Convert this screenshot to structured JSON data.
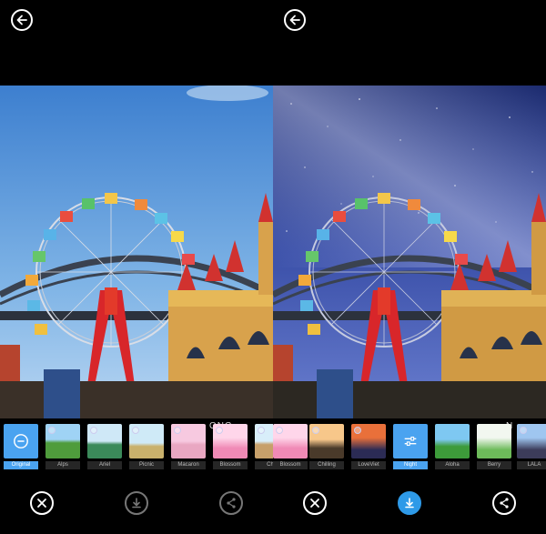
{
  "screens": [
    {
      "filters": [
        {
          "label": "Original",
          "selected": true,
          "colors": [
            "#4aa3f0",
            "#4aa3f0"
          ]
        },
        {
          "label": "Alps",
          "colors": [
            "#9fd3f5",
            "#4f9c3c"
          ]
        },
        {
          "label": "Ariel",
          "colors": [
            "#cfe8f7",
            "#3b8a5a"
          ]
        },
        {
          "label": "Picnic",
          "colors": [
            "#cfeaf7",
            "#c9b16c"
          ]
        },
        {
          "label": "Macaron",
          "colors": [
            "#f7c9e0",
            "#e9a7c2"
          ]
        },
        {
          "label": "Blossom",
          "colors": [
            "#ffd6ea",
            "#f08ab6"
          ]
        },
        {
          "label": "Chill",
          "colors": [
            "#d8eefa",
            "#c7a06a"
          ]
        }
      ],
      "caption": "ONC",
      "buttons": {
        "close": "close",
        "download": "download",
        "share": "share"
      }
    },
    {
      "filters": [
        {
          "label": "Blossom",
          "colors": [
            "#ffd6ea",
            "#f08ab6"
          ]
        },
        {
          "label": "Chilling",
          "colors": [
            "#f7c78a",
            "#4a3a2a"
          ]
        },
        {
          "label": "LoveViet",
          "colors": [
            "#e9703a",
            "#2b2b55"
          ]
        },
        {
          "label": "Night",
          "selected": true,
          "colors": [
            "#4aa3f0",
            "#4aa3f0"
          ]
        },
        {
          "label": "Aloha",
          "colors": [
            "#7ec8f2",
            "#3d9b3a"
          ]
        },
        {
          "label": "Berry",
          "colors": [
            "#f2f7f0",
            "#6dbb5a"
          ]
        },
        {
          "label": "LALA",
          "colors": [
            "#9fc6f0",
            "#3c3c5a"
          ]
        }
      ],
      "caption": "N",
      "buttons": {
        "close": "close",
        "download": "download",
        "share": "share"
      }
    }
  ],
  "colors": {
    "accent": "#2e9ae8",
    "background": "#000000"
  }
}
